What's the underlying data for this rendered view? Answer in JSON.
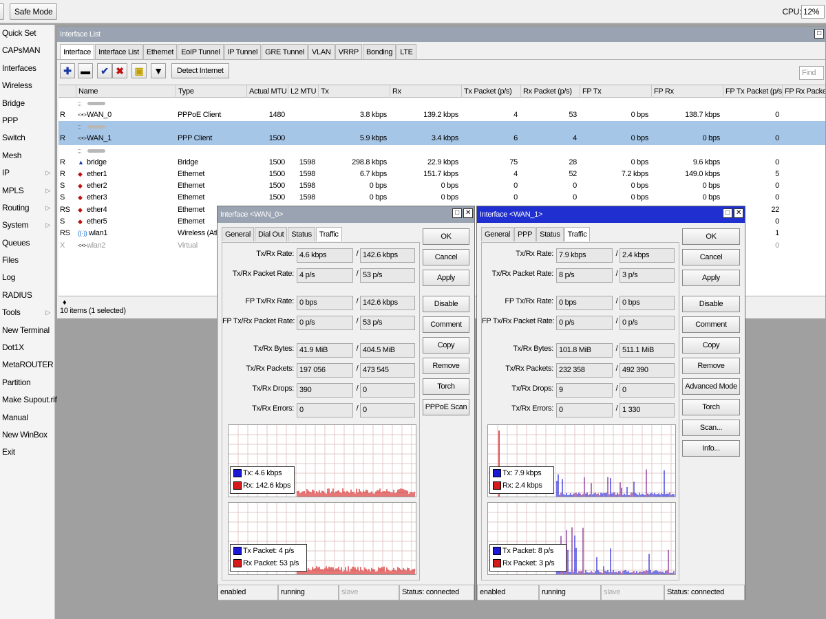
{
  "toolbar": {
    "safe_mode": "Safe Mode",
    "cpu_label": "CPU:",
    "cpu_value": "12%"
  },
  "menu": [
    {
      "label": "Quick Set",
      "sub": false
    },
    {
      "label": "CAPsMAN",
      "sub": false
    },
    {
      "label": "Interfaces",
      "sub": false
    },
    {
      "label": "Wireless",
      "sub": false
    },
    {
      "label": "Bridge",
      "sub": false
    },
    {
      "label": "PPP",
      "sub": false
    },
    {
      "label": "Switch",
      "sub": false
    },
    {
      "label": "Mesh",
      "sub": false
    },
    {
      "label": "IP",
      "sub": true
    },
    {
      "label": "MPLS",
      "sub": true
    },
    {
      "label": "Routing",
      "sub": true
    },
    {
      "label": "System",
      "sub": true
    },
    {
      "label": "Queues",
      "sub": false
    },
    {
      "label": "Files",
      "sub": false
    },
    {
      "label": "Log",
      "sub": false
    },
    {
      "label": "RADIUS",
      "sub": false
    },
    {
      "label": "Tools",
      "sub": true
    },
    {
      "label": "New Terminal",
      "sub": false
    },
    {
      "label": "Dot1X",
      "sub": false
    },
    {
      "label": "MetaROUTER",
      "sub": false
    },
    {
      "label": "Partition",
      "sub": false
    },
    {
      "label": "Make Supout.rif",
      "sub": false
    },
    {
      "label": "Manual",
      "sub": false
    },
    {
      "label": "New WinBox",
      "sub": false
    },
    {
      "label": "Exit",
      "sub": false
    }
  ],
  "iface_window": {
    "title": "Interface List",
    "tabs": [
      "Interface",
      "Interface List",
      "Ethernet",
      "EoIP Tunnel",
      "IP Tunnel",
      "GRE Tunnel",
      "VLAN",
      "VRRP",
      "Bonding",
      "LTE"
    ],
    "detect_label": "Detect Internet",
    "find_placeholder": "Find",
    "columns": [
      "Name",
      "Type",
      "Actual MTU",
      "L2 MTU",
      "Tx",
      "Rx",
      "Tx Packet (p/s)",
      "Rx Packet (p/s)",
      "FP Tx",
      "FP Rx",
      "FP Tx Packet (p/s)",
      "FP Rx Packet (p/s)"
    ],
    "rows": [
      {
        "kind": "comment",
        "flag": ";;;",
        "name": ""
      },
      {
        "kind": "row",
        "flag": "R",
        "icon": "<•>",
        "name": "WAN_0",
        "type": "PPPoE Client",
        "mtu": "1480",
        "l2mtu": "",
        "tx": "3.8 kbps",
        "rx": "139.2 kbps",
        "txp": "4",
        "rxp": "53",
        "fptx": "0 bps",
        "fprx": "138.7 kbps",
        "fptxp": "0"
      },
      {
        "kind": "comment",
        "flag": ";;;",
        "name": "",
        "selected": true
      },
      {
        "kind": "row",
        "flag": "R",
        "icon": "<•>",
        "name": "WAN_1",
        "type": "PPP Client",
        "mtu": "1500",
        "l2mtu": "",
        "tx": "5.9 kbps",
        "rx": "3.4 kbps",
        "txp": "6",
        "rxp": "4",
        "fptx": "0 bps",
        "fprx": "0 bps",
        "fptxp": "0",
        "selected": true
      },
      {
        "kind": "comment",
        "flag": ";;;",
        "name": ""
      },
      {
        "kind": "row",
        "flag": "R",
        "icon": "▲",
        "name": "bridge",
        "type": "Bridge",
        "mtu": "1500",
        "l2mtu": "1598",
        "tx": "298.8 kbps",
        "rx": "22.9 kbps",
        "txp": "75",
        "rxp": "28",
        "fptx": "0 bps",
        "fprx": "9.6 kbps",
        "fptxp": "0"
      },
      {
        "kind": "row",
        "flag": "R",
        "icon": "◆",
        "name": "ether1",
        "type": "Ethernet",
        "mtu": "1500",
        "l2mtu": "1598",
        "tx": "6.7 kbps",
        "rx": "151.7 kbps",
        "txp": "4",
        "rxp": "52",
        "fptx": "7.2 kbps",
        "fprx": "149.0 kbps",
        "fptxp": "5"
      },
      {
        "kind": "row",
        "flag": "S",
        "icon": "◆",
        "name": "ether2",
        "type": "Ethernet",
        "mtu": "1500",
        "l2mtu": "1598",
        "tx": "0 bps",
        "rx": "0 bps",
        "txp": "0",
        "rxp": "0",
        "fptx": "0 bps",
        "fprx": "0 bps",
        "fptxp": "0"
      },
      {
        "kind": "row",
        "flag": "S",
        "icon": "◆",
        "name": "ether3",
        "type": "Ethernet",
        "mtu": "1500",
        "l2mtu": "1598",
        "tx": "0 bps",
        "rx": "0 bps",
        "txp": "0",
        "rxp": "0",
        "fptx": "0 bps",
        "fprx": "0 bps",
        "fptxp": "0"
      },
      {
        "kind": "row",
        "flag": "RS",
        "icon": "◆",
        "name": "ether4",
        "type": "Ethernet",
        "mtu": "",
        "l2mtu": "",
        "tx": "",
        "rx": "",
        "txp": "",
        "rxp": "",
        "fptx": "",
        "fprx": "",
        "fptxp": "22"
      },
      {
        "kind": "row",
        "flag": "S",
        "icon": "◆",
        "name": "ether5",
        "type": "Ethernet",
        "mtu": "",
        "l2mtu": "",
        "tx": "",
        "rx": "",
        "txp": "",
        "rxp": "",
        "fptx": "",
        "fprx": "",
        "fptxp": "0"
      },
      {
        "kind": "row",
        "flag": "RS",
        "icon": "((·))",
        "name": "wlan1",
        "type": "Wireless (Athe",
        "mtu": "",
        "l2mtu": "",
        "tx": "",
        "rx": "",
        "txp": "",
        "rxp": "",
        "fptx": "",
        "fprx": "",
        "fptxp": "1"
      },
      {
        "kind": "row",
        "flag": "X",
        "icon": "<•>",
        "name": "wlan2",
        "type": "Virtual",
        "mtu": "",
        "l2mtu": "",
        "tx": "",
        "rx": "",
        "txp": "",
        "rxp": "",
        "fptx": "",
        "fprx": "",
        "fptxp": "0",
        "dim": true
      }
    ],
    "footer_marker": "♦",
    "status": "10 items (1 selected)"
  },
  "dialogs": [
    {
      "title": "Interface <WAN_0>",
      "tabs": [
        "General",
        "Dial Out",
        "Status",
        "Traffic"
      ],
      "fields": [
        {
          "label": "Tx/Rx Rate:",
          "a": "4.6 kbps",
          "b": "142.6 kbps"
        },
        {
          "label": "Tx/Rx Packet Rate:",
          "a": "4 p/s",
          "b": "53 p/s"
        },
        {
          "label": "FP Tx/Rx Rate:",
          "a": "0 bps",
          "b": "142.6 kbps"
        },
        {
          "label": "FP Tx/Rx Packet Rate:",
          "a": "0 p/s",
          "b": "53 p/s"
        },
        {
          "label": "Tx/Rx Bytes:",
          "a": "41.9 MiB",
          "b": "404.5 MiB"
        },
        {
          "label": "Tx/Rx Packets:",
          "a": "197 056",
          "b": "473 545"
        },
        {
          "label": "Tx/Rx Drops:",
          "a": "390",
          "b": "0"
        },
        {
          "label": "Tx/Rx Errors:",
          "a": "0",
          "b": "0"
        }
      ],
      "buttons": [
        "OK",
        "Cancel",
        "Apply",
        "Disable",
        "Comment",
        "Copy",
        "Remove",
        "Torch",
        "PPPoE Scan"
      ],
      "legend1": [
        {
          "label": "Tx:",
          "value": "4.6 kbps",
          "color": "#1a1ad6"
        },
        {
          "label": "Rx:",
          "value": "142.6 kbps",
          "color": "#d41a1a"
        }
      ],
      "legend2": [
        {
          "label": "Tx Packet:",
          "value": "4 p/s",
          "color": "#1a1ad6"
        },
        {
          "label": "Rx Packet:",
          "value": "53 p/s",
          "color": "#d41a1a"
        }
      ],
      "status": [
        "enabled",
        "running",
        "slave",
        "Status: connected"
      ]
    },
    {
      "title": "Interface <WAN_1>",
      "tabs": [
        "General",
        "PPP",
        "Status",
        "Traffic"
      ],
      "fields": [
        {
          "label": "Tx/Rx Rate:",
          "a": "7.9 kbps",
          "b": "2.4 kbps"
        },
        {
          "label": "Tx/Rx Packet Rate:",
          "a": "8 p/s",
          "b": "3 p/s"
        },
        {
          "label": "FP Tx/Rx Rate:",
          "a": "0 bps",
          "b": "0 bps"
        },
        {
          "label": "FP Tx/Rx Packet Rate:",
          "a": "0 p/s",
          "b": "0 p/s"
        },
        {
          "label": "Tx/Rx Bytes:",
          "a": "101.8 MiB",
          "b": "511.1 MiB"
        },
        {
          "label": "Tx/Rx Packets:",
          "a": "232 358",
          "b": "492 390"
        },
        {
          "label": "Tx/Rx Drops:",
          "a": "9",
          "b": "0"
        },
        {
          "label": "Tx/Rx Errors:",
          "a": "0",
          "b": "1 330"
        }
      ],
      "buttons": [
        "OK",
        "Cancel",
        "Apply",
        "Disable",
        "Comment",
        "Copy",
        "Remove",
        "Advanced Mode",
        "Torch",
        "Scan...",
        "Info..."
      ],
      "legend1": [
        {
          "label": "Tx:",
          "value": "7.9 kbps",
          "color": "#1a1ad6"
        },
        {
          "label": "Rx:",
          "value": "2.4 kbps",
          "color": "#d41a1a"
        }
      ],
      "legend2": [
        {
          "label": "Tx Packet:",
          "value": "8 p/s",
          "color": "#1a1ad6"
        },
        {
          "label": "Rx Packet:",
          "value": "3 p/s",
          "color": "#d41a1a"
        }
      ],
      "status": [
        "enabled",
        "running",
        "slave",
        "Status: connected"
      ]
    }
  ],
  "colors": {
    "active_title": "#1f2fd0",
    "inactive_title": "#9aa3b1",
    "selection": "#a6c6e7",
    "tx": "#1a1ad6",
    "rx": "#d41a1a"
  }
}
